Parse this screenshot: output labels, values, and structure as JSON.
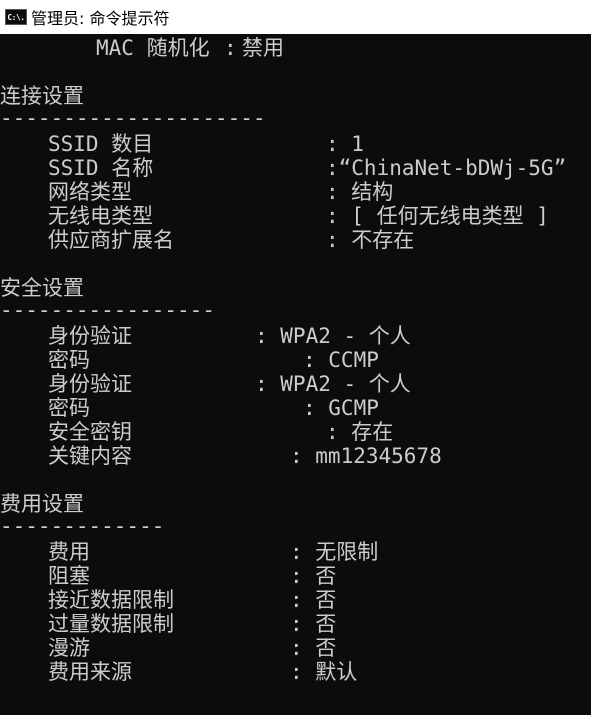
{
  "window": {
    "title": "管理员: 命令提示符",
    "icon_label": "C:\\."
  },
  "console": {
    "mac_randomization": {
      "label": "MAC 随机化",
      "value": "禁用"
    },
    "connection_settings": {
      "header": "连接设置",
      "separator": "---------------------",
      "rows": [
        {
          "label": "SSID 数目",
          "value": ": 1"
        },
        {
          "label": "SSID 名称",
          "value": ":“ChinaNet-bDWj-5G”"
        },
        {
          "label": "网络类型",
          "value": ": 结构"
        },
        {
          "label": "无线电类型",
          "value": ": [ 任何无线电类型 ]"
        },
        {
          "label": "供应商扩展名",
          "value": ": 不存在"
        }
      ]
    },
    "security_settings": {
      "header": "安全设置",
      "separator": "-----------------",
      "rows": [
        {
          "label": "身份验证",
          "value": ": WPA2 - 个人"
        },
        {
          "label": "密码",
          "value": ": CCMP"
        },
        {
          "label": "身份验证",
          "value": ": WPA2 - 个人"
        },
        {
          "label": "密码",
          "value": ": GCMP"
        },
        {
          "label": "安全密钥",
          "value": ": 存在"
        },
        {
          "label": "关键内容",
          "value": ": mm12345678"
        }
      ]
    },
    "cost_settings": {
      "header": "费用设置",
      "separator": "-------------",
      "rows": [
        {
          "label": "费用",
          "value": ": 无限制"
        },
        {
          "label": "阻塞",
          "value": ": 否"
        },
        {
          "label": "接近数据限制",
          "value": ": 否"
        },
        {
          "label": "过量数据限制",
          "value": ": 否"
        },
        {
          "label": "漫游",
          "value": ": 否"
        },
        {
          "label": "费用来源",
          "value": ": 默认"
        }
      ]
    }
  },
  "colors": {
    "console_background": "#0c0c0c",
    "console_text": "#cccccc",
    "titlebar_background": "#ffffff"
  }
}
